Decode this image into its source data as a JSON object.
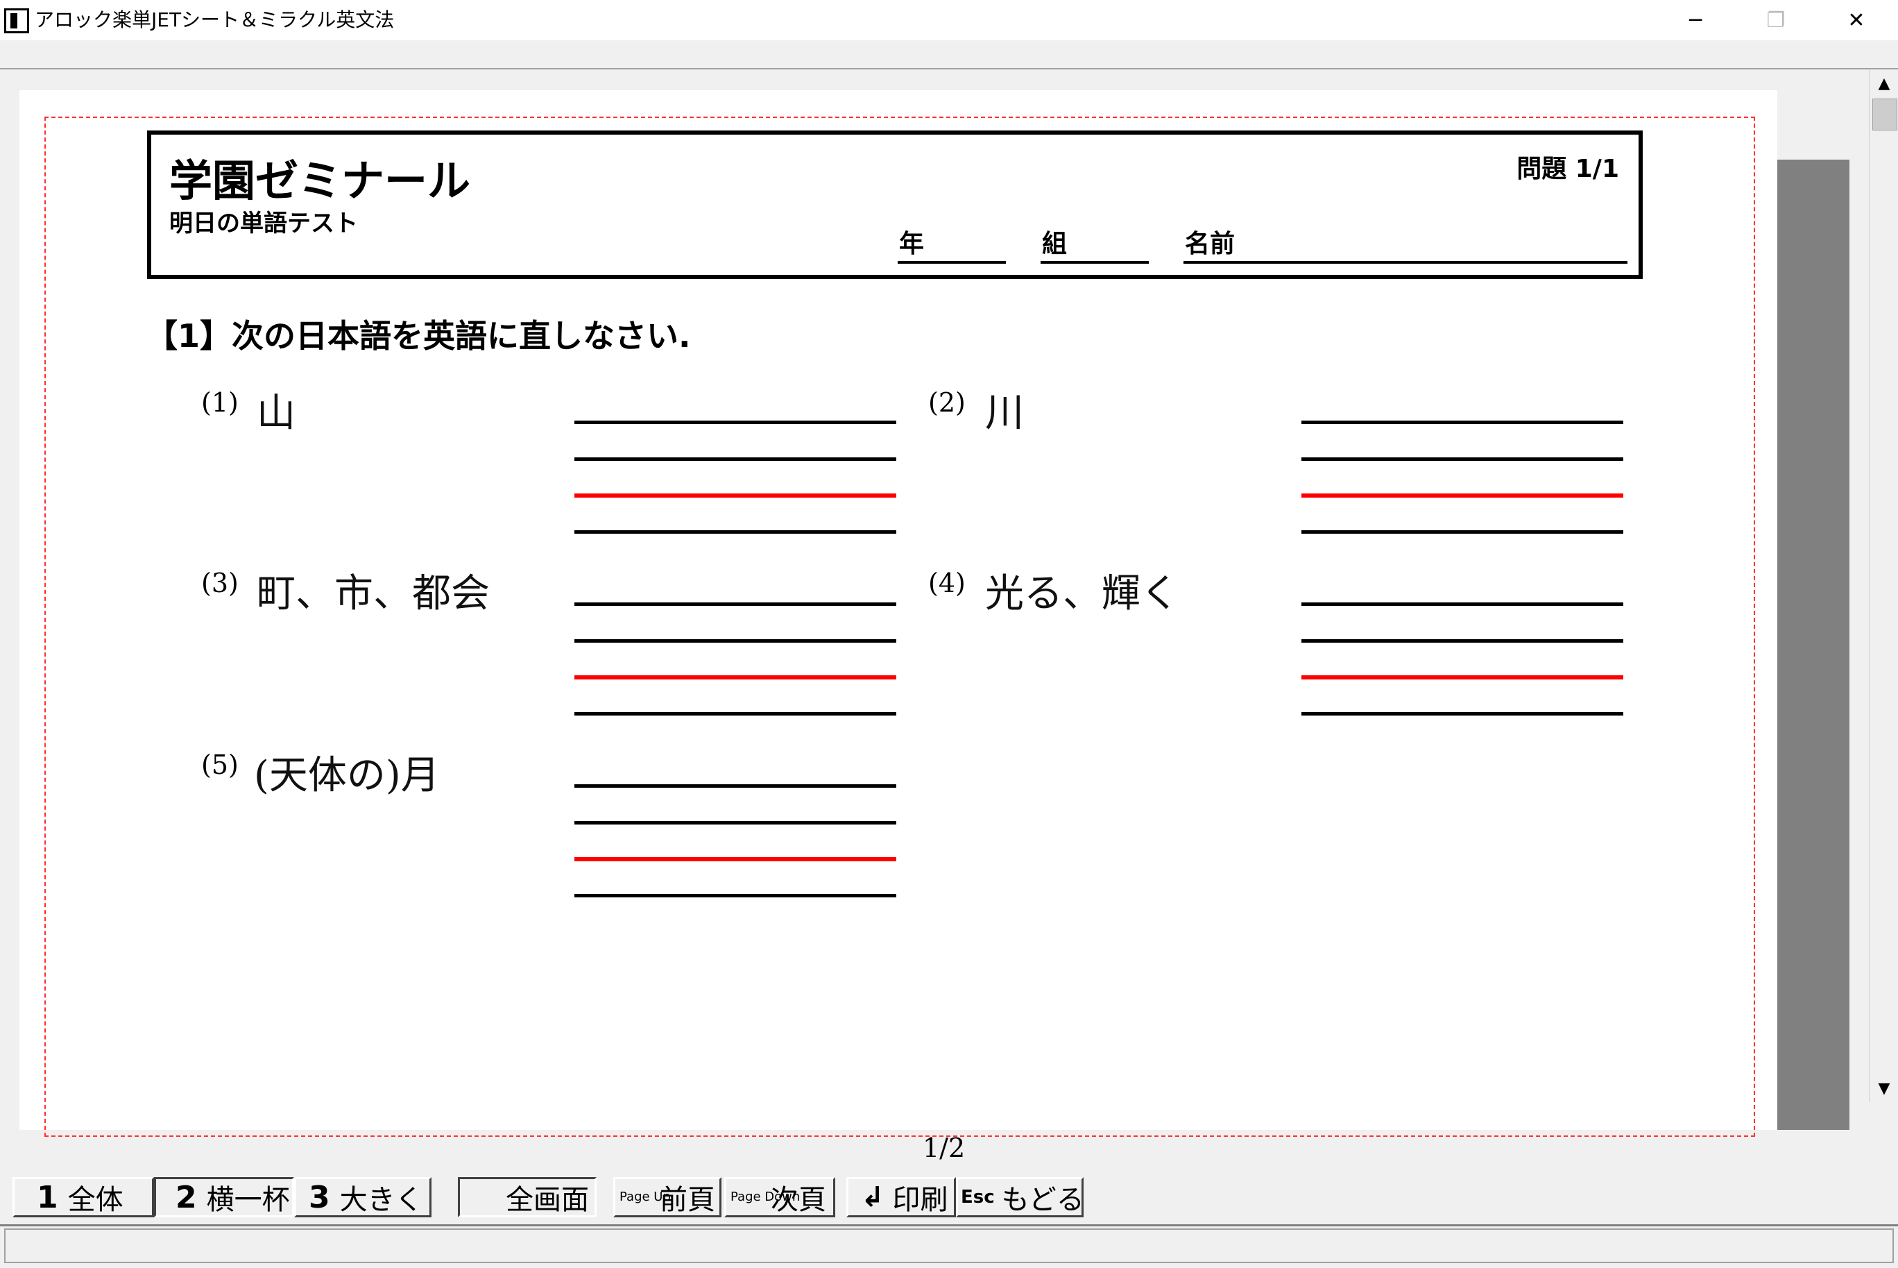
{
  "window": {
    "title": "アロック楽単JETシート＆ミラクル英文法",
    "minimize": "─",
    "maximize": "❐",
    "close": "✕"
  },
  "sheet": {
    "school_name": "学園ゼミナール",
    "test_name": "明日の単語テスト",
    "page_number": "問題 1/1",
    "fields": {
      "year": "年",
      "class": "組",
      "name": "名前"
    },
    "instruction": "【1】次の日本語を英語に直しなさい.",
    "questions": [
      {
        "number": "(1)",
        "word": "山"
      },
      {
        "number": "(2)",
        "word": "川"
      },
      {
        "number": "(3)",
        "word": "町、市、都会"
      },
      {
        "number": "(4)",
        "word": "光る、輝く"
      },
      {
        "number": "(5)",
        "word": "(天体の)月"
      }
    ]
  },
  "viewer": {
    "page_indicator": "1/2"
  },
  "toolbar": {
    "whole": {
      "key": "1",
      "label": "全体"
    },
    "fit_width": {
      "key": "2",
      "label": "横一杯"
    },
    "enlarge": {
      "key": "3",
      "label": "大きく"
    },
    "fullscreen": {
      "label": "全画面"
    },
    "prev_page": {
      "key": "Page Up",
      "label": "前頁"
    },
    "next_page": {
      "key": "Page Down",
      "label": "次頁"
    },
    "print": {
      "key": "↲",
      "label": "印刷"
    },
    "back": {
      "key": "Esc",
      "label": "もどる"
    }
  },
  "colors": {
    "guide_line": "#ff0000",
    "page_border": "#ff3030",
    "panel_gray": "#808080"
  },
  "icons": {
    "scroll_up": "▲",
    "scroll_down": "▼"
  }
}
